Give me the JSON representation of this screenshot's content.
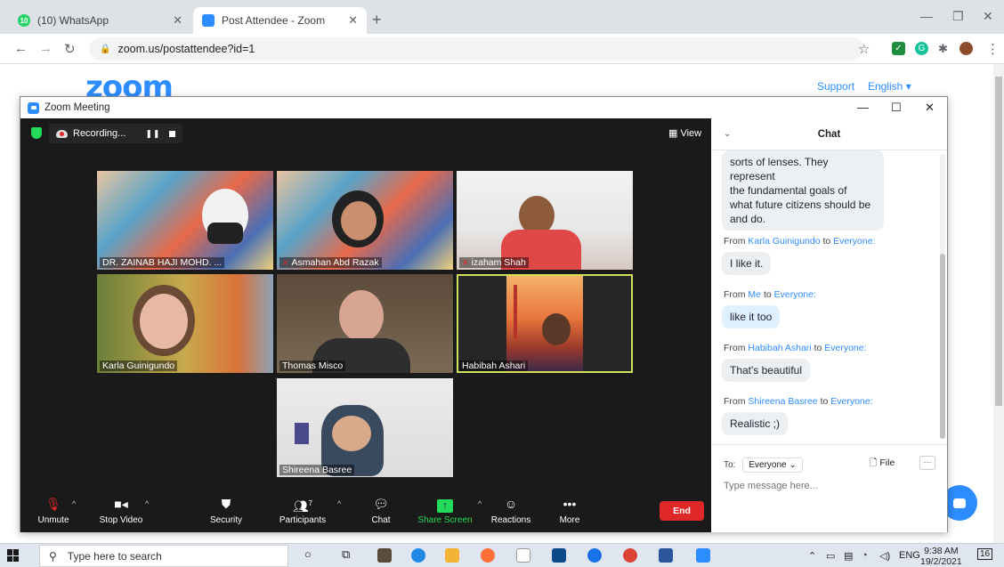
{
  "browser": {
    "tabs": [
      {
        "title": "(10) WhatsApp",
        "badge": "10",
        "active": false
      },
      {
        "title": "Post Attendee - Zoom",
        "active": true
      }
    ],
    "url": "zoom.us/postattendee?id=1"
  },
  "site": {
    "logo": "zoom",
    "support": "Support",
    "language": "English ▾"
  },
  "meeting": {
    "window_title": "Zoom Meeting",
    "recording_label": "Recording...",
    "view_label": "View",
    "participants": [
      {
        "name": "DR. ZAINAB HAJI MOHD. ...",
        "muted": false
      },
      {
        "name": "Asmahan Abd Razak",
        "muted": true
      },
      {
        "name": "izaham Shah",
        "muted": true
      },
      {
        "name": "Karla Guinigundo",
        "muted": false
      },
      {
        "name": "Thomas Misco",
        "muted": false
      },
      {
        "name": "Habibah Ashari",
        "muted": false,
        "active_speaker": true
      },
      {
        "name": "Shireena Basree",
        "muted": false
      }
    ],
    "controls": {
      "unmute": "Unmute",
      "stop_video": "Stop Video",
      "security": "Security",
      "participants": "Participants",
      "participants_count": "7",
      "chat": "Chat",
      "share_screen": "Share Screen",
      "reactions": "Reactions",
      "more": "More",
      "end": "End"
    }
  },
  "chat": {
    "title": "Chat",
    "first_bubble": [
      "sorts of lenses. They represent",
      "the fundamental goals of",
      "what future citizens should be",
      "and do."
    ],
    "messages": [
      {
        "prefix": "From",
        "sender": "Karla Guinigundo",
        "to": "to",
        "recipient": "Everyone:",
        "text": "I like it."
      },
      {
        "prefix": "From",
        "sender": "Me",
        "to": "to",
        "recipient": "Everyone:",
        "text": "like it too"
      },
      {
        "prefix": "From",
        "sender": "Habibah Ashari",
        "to": "to",
        "recipient": "Everyone:",
        "text": "That's beautiful"
      },
      {
        "prefix": "From",
        "sender": "Shireena Basree",
        "to": "to",
        "recipient": "Everyone:",
        "text": "Realistic ;)"
      }
    ],
    "to_label": "To:",
    "to_value": "Everyone ⌄",
    "file_label": "File",
    "more_label": "···",
    "input_placeholder": "Type message here..."
  },
  "taskbar": {
    "search_placeholder": "Type here to search",
    "language": "ENG",
    "time": "9:38 AM",
    "date": "19/2/2021",
    "notification_count": "16"
  }
}
